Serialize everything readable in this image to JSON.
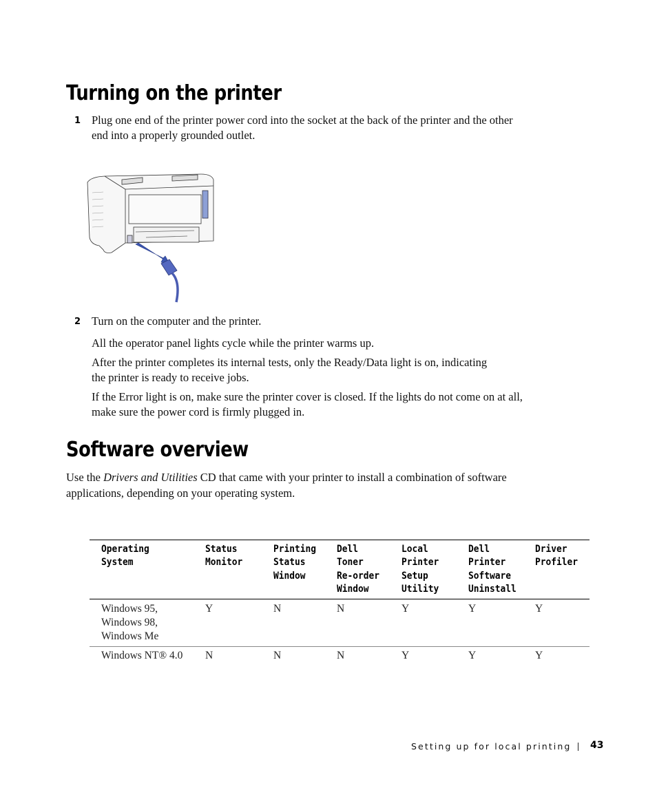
{
  "sections": {
    "turning_on": {
      "heading": "Turning on the printer",
      "steps": [
        {
          "number": "1",
          "text": "Plug one end of the printer power cord into the socket at the back of the printer and the other end into a properly grounded outlet."
        },
        {
          "number": "2",
          "text": "Turn on the computer and the printer.",
          "notes": [
            "All the operator panel lights cycle while the printer warms up.",
            "After the printer completes its internal tests, only the Ready/Data light is on, indicating the printer is ready to receive jobs.",
            "If the Error light is on, make sure the printer cover is closed. If the lights do not come on at all, make sure the power cord is firmly plugged in."
          ]
        }
      ],
      "figure": {
        "description": "Rear view of printer with power cord being plugged into socket",
        "icon": "printer-power-cord-illustration",
        "accent_color": "#3b55b0"
      }
    },
    "software_overview": {
      "heading": "Software overview",
      "intro_before": "Use the ",
      "intro_italic": "Drivers and Utilities",
      "intro_after": " CD that came with your printer to install a combination of software applications, depending on your operating system.",
      "table": {
        "headers": [
          "Operating\nSystem",
          "Status\nMonitor",
          "Printing\nStatus\nWindow",
          "Dell\nToner\nRe-order\nWindow",
          "Local\nPrinter\nSetup\nUtility",
          "Dell\nPrinter\nSoftware\nUninstall",
          "Driver\nProfiler"
        ],
        "rows": [
          [
            "Windows 95,\nWindows 98,\nWindows Me",
            "Y",
            "N",
            "N",
            "Y",
            "Y",
            "Y"
          ],
          [
            "Windows NT® 4.0",
            "N",
            "N",
            "N",
            "Y",
            "Y",
            "Y"
          ]
        ]
      }
    }
  },
  "footer": {
    "chapter_title": "Setting up for local printing",
    "separator": "|",
    "page_number": "43"
  }
}
